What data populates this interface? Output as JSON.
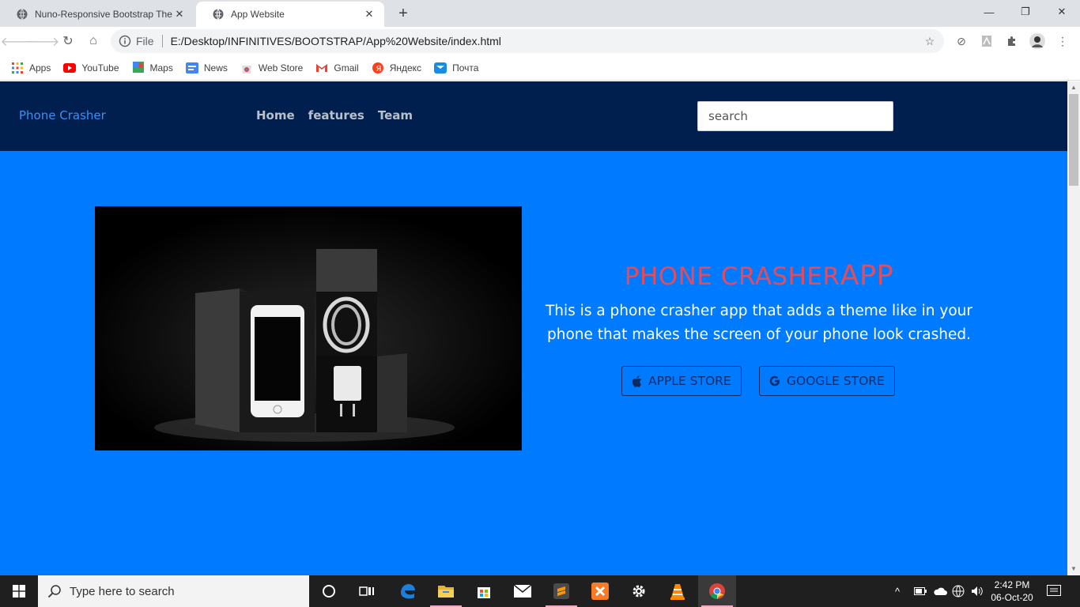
{
  "browser": {
    "tabs": [
      {
        "title": "Nuno-Responsive Bootstrap Ther",
        "active": false
      },
      {
        "title": "App Website",
        "active": true
      }
    ],
    "omnibox": {
      "scheme_label": "File",
      "url": "E:/Desktop/INFINITIVES/BOOTSTRAP/App%20Website/index.html"
    },
    "bookmarks": [
      "Apps",
      "YouTube",
      "Maps",
      "News",
      "Web Store",
      "Gmail",
      "Яндекс",
      "Почта"
    ]
  },
  "site": {
    "brand": "Phone Crasher",
    "nav": [
      "Home",
      "features",
      "Team"
    ],
    "search_placeholder": "search",
    "hero": {
      "title_main": "PHONE CRASHER",
      "title_suffix": "APP",
      "description": "This is a phone crasher app that adds a theme like in your phone that makes the screen of your phone look crashed.",
      "buttons": [
        "APPLE STORE",
        "GOOGLE STORE"
      ]
    }
  },
  "taskbar": {
    "search_placeholder": "Type here to search",
    "time": "2:42 PM",
    "date": "06-Oct-20"
  },
  "colors": {
    "page_bg": "#007bff",
    "navbar_bg": "#001f4e",
    "title_red": "#e64b5b",
    "button_border": "#0b2b66"
  }
}
